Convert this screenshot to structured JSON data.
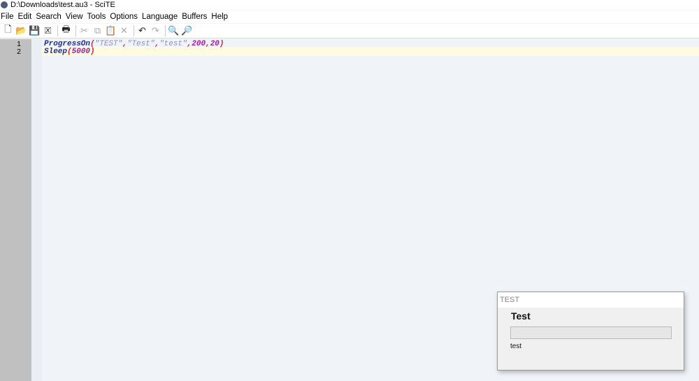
{
  "window": {
    "title": "D:\\Downloads\\test.au3 - SciTE"
  },
  "menu": [
    "File",
    "Edit",
    "Search",
    "View",
    "Tools",
    "Options",
    "Language",
    "Buffers",
    "Help"
  ],
  "toolbar": [
    {
      "name": "new-file-icon",
      "glyph": "🗋",
      "enabled": true
    },
    {
      "name": "open-folder-icon",
      "glyph": "📂",
      "enabled": true
    },
    {
      "name": "save-icon",
      "glyph": "💾",
      "enabled": true
    },
    {
      "name": "close-file-icon",
      "glyph": "🗵",
      "enabled": true
    },
    {
      "sep": true
    },
    {
      "name": "print-icon",
      "glyph": "🖶",
      "enabled": true
    },
    {
      "sep": true
    },
    {
      "name": "cut-icon",
      "glyph": "✂",
      "enabled": false
    },
    {
      "name": "copy-icon",
      "glyph": "⧉",
      "enabled": false
    },
    {
      "name": "paste-icon",
      "glyph": "📋",
      "enabled": true
    },
    {
      "name": "delete-icon",
      "glyph": "✕",
      "enabled": false
    },
    {
      "sep": true
    },
    {
      "name": "undo-icon",
      "glyph": "↶",
      "enabled": true
    },
    {
      "name": "redo-icon",
      "glyph": "↷",
      "enabled": false
    },
    {
      "sep": true
    },
    {
      "name": "find-icon",
      "glyph": "🔍",
      "enabled": true
    },
    {
      "name": "replace-icon",
      "glyph": "🔎",
      "enabled": true
    }
  ],
  "editor": {
    "lines": [
      {
        "number": "1",
        "tokens": [
          {
            "t": "ProgressOn",
            "c": "fn"
          },
          {
            "t": "(",
            "c": "op"
          },
          {
            "t": "\"TEST\"",
            "c": "str"
          },
          {
            "t": ",",
            "c": "op"
          },
          {
            "t": "\"Test\"",
            "c": "str"
          },
          {
            "t": ",",
            "c": "op"
          },
          {
            "t": "\"test\"",
            "c": "str"
          },
          {
            "t": ",",
            "c": "op"
          },
          {
            "t": "200",
            "c": "num"
          },
          {
            "t": ",",
            "c": "op"
          },
          {
            "t": "20",
            "c": "num"
          },
          {
            "t": ")",
            "c": "op"
          }
        ]
      },
      {
        "number": "2",
        "tokens": [
          {
            "t": "Sleep",
            "c": "fn"
          },
          {
            "t": "(",
            "c": "op"
          },
          {
            "t": "5000",
            "c": "num"
          },
          {
            "t": ")",
            "c": "op"
          }
        ]
      }
    ],
    "current_line": 2
  },
  "progress_dialog": {
    "title": "TEST",
    "main_text": "Test",
    "sub_text": "test",
    "progress_percent": 0
  }
}
